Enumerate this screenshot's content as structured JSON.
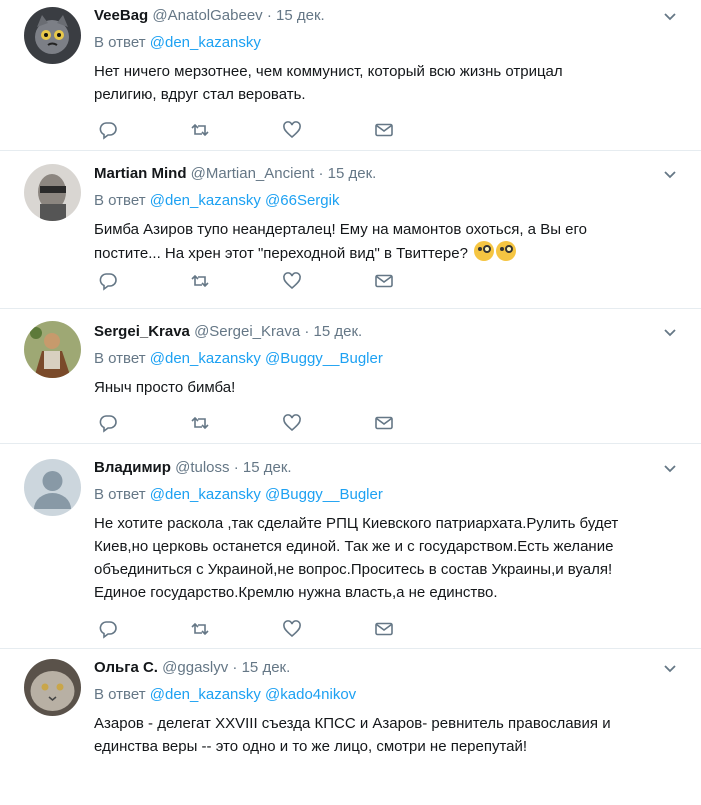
{
  "reply_prefix": "В ответ",
  "tweets": [
    {
      "name": "VeeBag",
      "handle": "@AnatolGabeev",
      "date": "15 дек.",
      "reply_to": [
        "@den_kazansky"
      ],
      "text": "Нет ничего мерзотнее, чем коммунист, который всю жизнь отрицал\nрелигию, вдруг стал веровать.",
      "avatar_color": "#3a3d42"
    },
    {
      "name": "Martian Mind",
      "handle": "@Martian_Ancient",
      "date": "15 дек.",
      "reply_to": [
        "@den_kazansky",
        "@66Sergik"
      ],
      "text": "Бимба Азиров тупо неандерталец! Ему на мамонтов охоться, а Вы его\nпостите... На хрен этот \"переходной вид\" в Твиттере?",
      "emoji": "face-with-monocle-icon",
      "avatar_color": "#8c8680"
    },
    {
      "name": "Sergei_Krava",
      "handle": "@Sergei_Krava",
      "date": "15 дек.",
      "reply_to": [
        "@den_kazansky",
        "@Buggy__Bugler"
      ],
      "text": "Яныч просто бимба!",
      "avatar_color": "#7a6a3a"
    },
    {
      "name": "Владимир",
      "handle": "@tuloss",
      "date": "15 дек.",
      "reply_to": [
        "@den_kazansky",
        "@Buggy__Bugler"
      ],
      "text": "Не хотите раскола ,так сделайте РПЦ Киевского патриархата.Рулить будет\nКиев,но церковь останется единой. Так же и с государством.Есть желание\nобъединиться с Украиной,не вопрос.Проситесь в состав Украины,и вуаля!\nЕдиное государство.Кремлю нужна власть,а не единство.",
      "avatar_color": "#ccd6dd"
    },
    {
      "name": "Ольга С.",
      "handle": "@ggaslyv",
      "date": "15 дек.",
      "reply_to": [
        "@den_kazansky",
        "@kado4nikov"
      ],
      "text": "Азаров - делегат XXVIII съезда КПСС  и Азаров- ревнитель православия и\nединства веры -- это одно и то же лицо, смотри не перепутай!",
      "avatar_color": "#9a938a"
    }
  ],
  "colors": {
    "link": "#1da1f2",
    "muted": "#657786",
    "text": "#14171a",
    "divider": "#e6ecf0"
  },
  "action_icons": [
    "reply-icon",
    "retweet-icon",
    "like-icon",
    "direct-message-icon"
  ]
}
